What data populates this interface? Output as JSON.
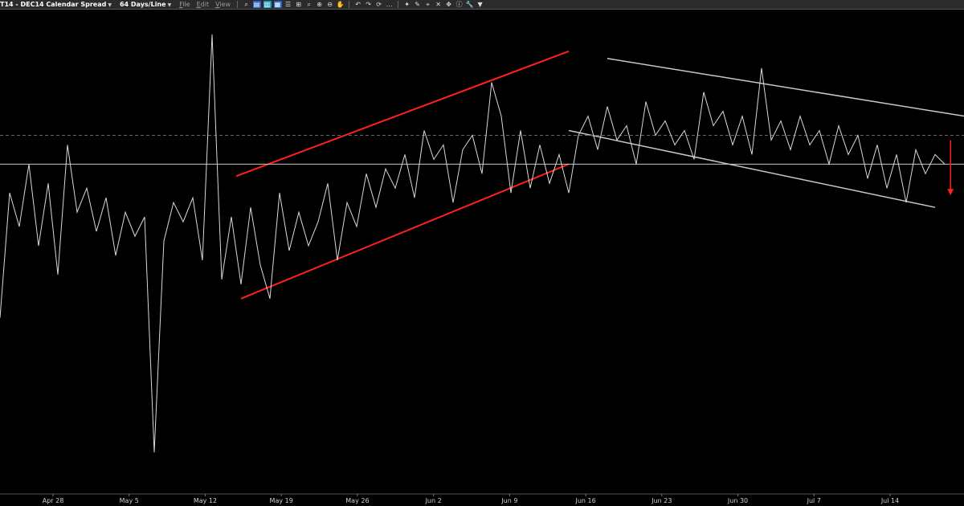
{
  "toolbar": {
    "title": "T14 - DEC14 Calendar Spread",
    "interval": "64 Days/Line",
    "menus": [
      "File",
      "Edit",
      "View"
    ],
    "icons": [
      "zoom-icon",
      "chart-icon",
      "layout-icon",
      "table-icon",
      "settings-icon",
      "grid-icon",
      "magnify-icon",
      "zoom-in-icon",
      "zoom-out-icon",
      "hand-icon",
      "undo-icon",
      "redo-icon",
      "refresh-icon",
      "more-icon",
      "tools-icon",
      "pencil-icon",
      "crosshair-icon",
      "cross-icon",
      "move-icon",
      "info-icon",
      "wrench-icon",
      "dropdown-icon"
    ]
  },
  "colors": {
    "background": "#000000",
    "price_line": "#d9d9d9",
    "up_channel": "#ff2020",
    "down_channel": "#c8c8c8",
    "arrow": "#ff2020"
  },
  "chart_data": {
    "type": "line",
    "title": "",
    "xlabel": "",
    "ylabel": "",
    "x_ticks": [
      "Apr 28",
      "May 5",
      "May 12",
      "May 19",
      "May 26",
      "Jun 2",
      "Jun 9",
      "Jun 16",
      "Jun 23",
      "Jun 30",
      "Jul 7",
      "Jul 14"
    ],
    "x_range": [
      0,
      100
    ],
    "y_range": [
      0,
      100
    ],
    "y_axis_visible": false,
    "grid": false,
    "series": [
      {
        "x": [
          0,
          1,
          2,
          3,
          4,
          5,
          6,
          7,
          8,
          9,
          10,
          11,
          12,
          13,
          14,
          15,
          16,
          17,
          18,
          19,
          20,
          21,
          22,
          23,
          24,
          25,
          26,
          27,
          28,
          29,
          30,
          31,
          32,
          33,
          34,
          35,
          36,
          37,
          38,
          39,
          40,
          41,
          42,
          43,
          44,
          45,
          46,
          47,
          48,
          49,
          50,
          51,
          52,
          53,
          54,
          55,
          56,
          57,
          58,
          59,
          60,
          61,
          62,
          63,
          64,
          65,
          66,
          67,
          68,
          69,
          70,
          71,
          72,
          73,
          74,
          75,
          76,
          77,
          78,
          79,
          80,
          81,
          82,
          83,
          84,
          85,
          86,
          87,
          88,
          89,
          90,
          91,
          92,
          93,
          94,
          95,
          96,
          97,
          98
        ],
        "values": [
          36,
          62,
          55,
          68,
          51,
          64,
          45,
          72,
          58,
          63,
          54,
          61,
          49,
          58,
          53,
          57,
          8,
          52,
          60,
          56,
          61,
          48,
          95,
          44,
          57,
          43,
          59,
          47,
          40,
          62,
          50,
          58,
          51,
          56,
          64,
          48,
          60,
          55,
          66,
          59,
          67,
          63,
          70,
          61,
          75,
          69,
          72,
          60,
          71,
          74,
          66,
          85,
          78,
          62,
          75,
          63,
          72,
          64,
          70,
          62,
          74,
          78,
          71,
          80,
          73,
          76,
          68,
          81,
          74,
          77,
          72,
          75,
          69,
          83,
          76,
          79,
          72,
          78,
          70,
          88,
          73,
          77,
          71,
          78,
          72,
          75,
          68,
          76,
          70,
          74,
          65,
          72,
          63,
          70,
          60,
          71,
          66,
          70,
          68
        ]
      }
    ],
    "annotations": [
      {
        "type": "trendline",
        "color": "#ff2020",
        "x1": 24.5,
        "y1": 65.5,
        "x2": 59,
        "y2": 91.5
      },
      {
        "type": "trendline",
        "color": "#ff2020",
        "x1": 25,
        "y1": 40,
        "x2": 59,
        "y2": 68
      },
      {
        "type": "trendline",
        "color": "#c8c8c8",
        "x1": 63,
        "y1": 90,
        "x2": 100,
        "y2": 78
      },
      {
        "type": "trendline",
        "color": "#c8c8c8",
        "x1": 59,
        "y1": 75,
        "x2": 97,
        "y2": 59
      },
      {
        "type": "hline",
        "style": "solid",
        "color": "#c8c8c8",
        "y": 68
      },
      {
        "type": "hline",
        "style": "dashed",
        "color": "#666666",
        "y": 74
      },
      {
        "type": "arrow",
        "direction": "down",
        "color": "#ff2020",
        "x": 98.6,
        "y1": 73,
        "y2": 61.5
      }
    ]
  }
}
